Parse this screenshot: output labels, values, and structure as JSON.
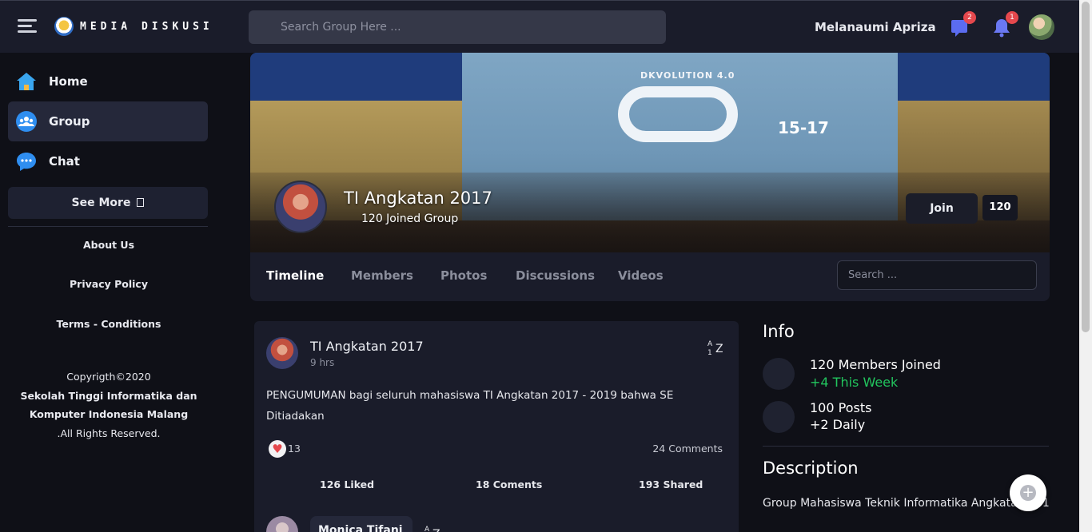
{
  "app": {
    "logo_text": "MEDIA DISKUSI",
    "search_placeholder": "Search Group Here ...",
    "user_name": "Melanaumi Apriza",
    "message_badge": "2",
    "notification_badge": "1"
  },
  "sidebar": {
    "items": [
      {
        "label": "Home",
        "icon": "home-icon"
      },
      {
        "label": "Group",
        "icon": "group-icon",
        "active": true
      },
      {
        "label": "Chat",
        "icon": "chat-icon"
      }
    ],
    "see_more": "See More",
    "links": [
      "About Us",
      "Privacy Policy",
      "Terms - Conditions"
    ],
    "copyright_line1": "Copyrigth©2020",
    "copyright_org1": "Sekolah Tinggi Informatika dan",
    "copyright_org2": "Komputer Indonesia Malang",
    "copyright_line3": ".All Rights Reserved."
  },
  "cover": {
    "banner_title": "DKVOLUTION 4.0",
    "banner_date": "15-17",
    "group_name": "TI Angkatan 2017",
    "joined_text": "120 Joined Group",
    "join_label": "Join",
    "join_count": "120"
  },
  "tabs": {
    "items": [
      "Timeline",
      "Members",
      "Photos",
      "Discussions",
      "Videos"
    ],
    "active": "Timeline",
    "search_placeholder": "Search ..."
  },
  "post": {
    "author": "TI Angkatan 2017",
    "time": "9 hrs",
    "text": "PENGUMUMAN bagi seluruh mahasiswa TI Angkatan 2017 - 2019 bahwa SE Ditiadakan",
    "reactions": "13",
    "comments_count": "24 Comments",
    "liked": "126 Liked",
    "comments": "18 Coments",
    "shared": "193 Shared",
    "translate_glyph": "↓A̒",
    "comment_author": "Monica Tifani"
  },
  "info": {
    "title": "Info",
    "members_line": "120  Members Joined",
    "members_week": "+4 This Week",
    "posts_line": "100  Posts",
    "posts_daily": "+2 Daily",
    "description_title": "Description",
    "description_text": "Group Mahasiswa Teknik Informatika Angkatan 2017"
  },
  "colors": {
    "background": "#0f1017",
    "panel": "#1a1c2a",
    "accent_green": "#22c55e",
    "badge_red": "#e5484d"
  }
}
